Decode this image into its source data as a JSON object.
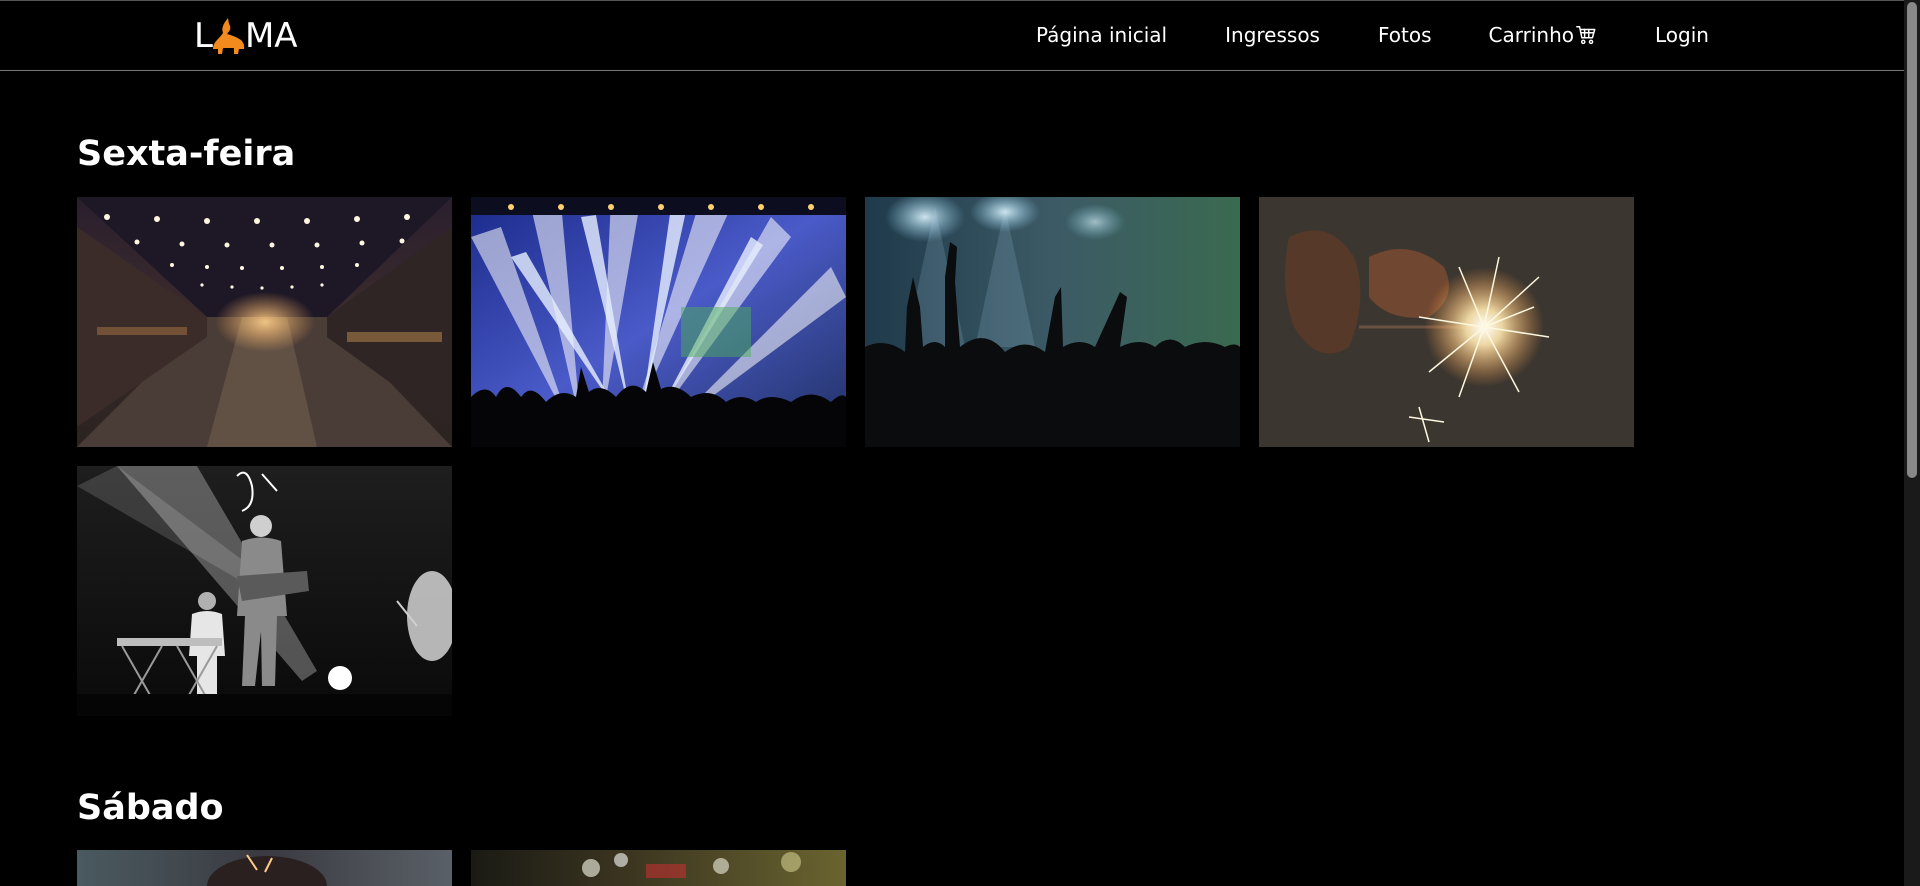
{
  "app": {
    "logo_letters_left": "L",
    "logo_letters_right": "MA",
    "accent_color": "#f28a1e",
    "background_color": "#000000"
  },
  "nav": {
    "items": [
      {
        "label": "Página inicial"
      },
      {
        "label": "Ingressos"
      },
      {
        "label": "Fotos"
      },
      {
        "label": "Carrinho",
        "icon": "cart-icon"
      },
      {
        "label": "Login"
      }
    ]
  },
  "gallery": {
    "sections": [
      {
        "title": "Sexta-feira",
        "photos": [
          "warehouse-lights",
          "stage-light-beams",
          "crowd-hands-up",
          "sparkler-hand",
          "band-black-white"
        ]
      },
      {
        "title": "Sábado",
        "photos": [
          "crowd-evening",
          "festival-bokeh"
        ]
      }
    ]
  }
}
